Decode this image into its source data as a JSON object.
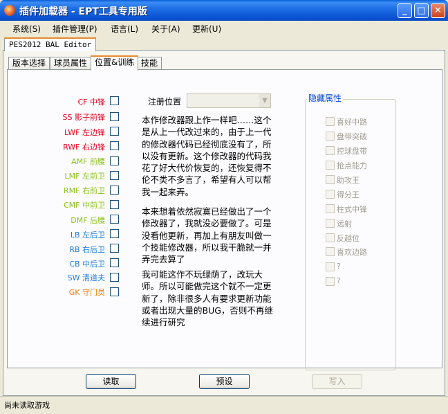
{
  "window": {
    "title": "插件加载器 - EPT工具专用版"
  },
  "menu": [
    "系统(S)",
    "插件管理(P)",
    "语言(L)",
    "关于(A)",
    "更新(U)"
  ],
  "outer_tab": "PES2012 BAL Editor",
  "tabs": [
    "版本选择",
    "球员属性",
    "位置&训练",
    "技能"
  ],
  "active_tab": "位置&训练",
  "positions": [
    {
      "label": "CF 中锋",
      "color": "#e8001c"
    },
    {
      "label": "SS 影子前锋",
      "color": "#e8001c"
    },
    {
      "label": "LWF 左边锋",
      "color": "#e8001c"
    },
    {
      "label": "RWF 右边锋",
      "color": "#e8001c"
    },
    {
      "label": "AMF 前腰",
      "color": "#8cc21c"
    },
    {
      "label": "LMF 左前卫",
      "color": "#8cc21c"
    },
    {
      "label": "RMF 右前卫",
      "color": "#8cc21c"
    },
    {
      "label": "CMF 中前卫",
      "color": "#8cc21c"
    },
    {
      "label": "DMF 后腰",
      "color": "#8cc21c"
    },
    {
      "label": "LB 左后卫",
      "color": "#1f7de0"
    },
    {
      "label": "RB 右后卫",
      "color": "#1f7de0"
    },
    {
      "label": "CB 中后卫",
      "color": "#1f7de0"
    },
    {
      "label": "SW 清道夫",
      "color": "#1f7de0"
    },
    {
      "label": "GK 守门员",
      "color": "#f07c00"
    }
  ],
  "register": {
    "label": "注册位置",
    "value": ""
  },
  "notes": [
    "本作修改器跟上作一样吧……这个是从上一代改过来的，由于上一代的修改器代码已经彻底没有了，所以没有更新。这个修改器的代码我花了好大代价恢复的，还恢复得不伦不类不多言了，希望有人可以帮我一起来弄。",
    "本来想着依然寂寞已经做出了一个修改器了，我就没必要做了。可是没看他更新，再加上有朋友叫做一个技能修改器，所以我干脆就一并弄完去算了",
    "我可能这作不玩绿荫了，改玩大师。所以可能做完这个就不一定更新了，除非很多人有要求更新功能或者出现大量的BUG，否则不再继续进行研究"
  ],
  "hidden_attrs": {
    "title": "隐藏属性",
    "items": [
      "喜好中路",
      "盘带突破",
      "控球盘带",
      "抢点能力",
      "助攻王",
      "得分王",
      "柱式中锋",
      "远射",
      "反越位",
      "喜欢边路",
      "?",
      "?"
    ]
  },
  "buttons": {
    "read": "读取",
    "preset": "预设",
    "write": "写入"
  },
  "status": "尚未读取游戏"
}
